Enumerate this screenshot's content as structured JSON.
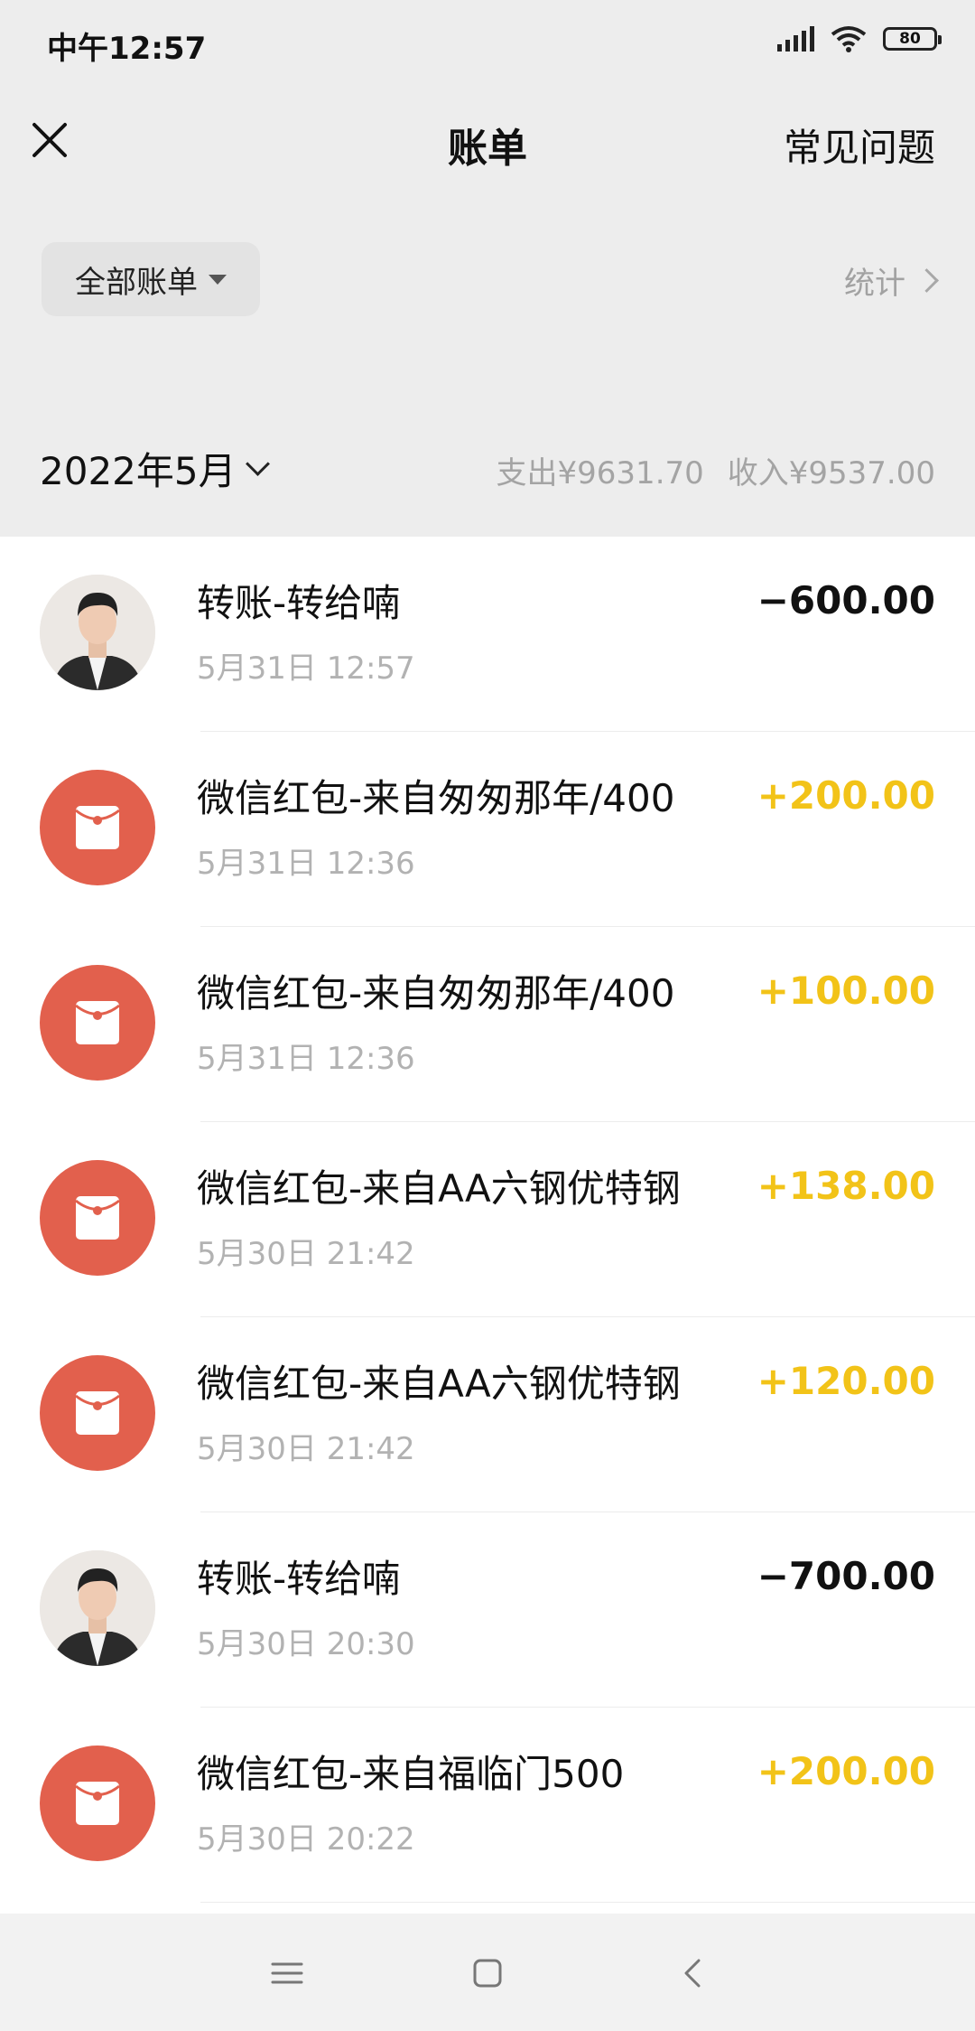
{
  "status": {
    "time": "中午12:57",
    "battery": "80"
  },
  "header": {
    "title": "账单",
    "faq": "常见问题"
  },
  "filter": {
    "label": "全部账单",
    "stats": "统计"
  },
  "month": {
    "label": "2022年5月",
    "expense": "支出¥9631.70",
    "income": "收入¥9537.00"
  },
  "transactions": [
    {
      "type": "transfer",
      "title": "转账-转给喃",
      "time": "5月31日 12:57",
      "amount": "−600.00",
      "direction": "out"
    },
    {
      "type": "redpacket",
      "title": "微信红包-来自匆匆那年/400",
      "time": "5月31日 12:36",
      "amount": "+200.00",
      "direction": "in"
    },
    {
      "type": "redpacket",
      "title": "微信红包-来自匆匆那年/400",
      "time": "5月31日 12:36",
      "amount": "+100.00",
      "direction": "in"
    },
    {
      "type": "redpacket",
      "title": "微信红包-来自AA六钢优特钢",
      "time": "5月30日 21:42",
      "amount": "+138.00",
      "direction": "in"
    },
    {
      "type": "redpacket",
      "title": "微信红包-来自AA六钢优特钢",
      "time": "5月30日 21:42",
      "amount": "+120.00",
      "direction": "in"
    },
    {
      "type": "transfer",
      "title": "转账-转给喃",
      "time": "5月30日 20:30",
      "amount": "−700.00",
      "direction": "out"
    },
    {
      "type": "redpacket",
      "title": "微信红包-来自福临门500",
      "time": "5月30日 20:22",
      "amount": "+200.00",
      "direction": "in"
    }
  ],
  "colors": {
    "income": "#f2c318",
    "redpacket": "#e2604d",
    "muted": "#a4a4a4"
  }
}
